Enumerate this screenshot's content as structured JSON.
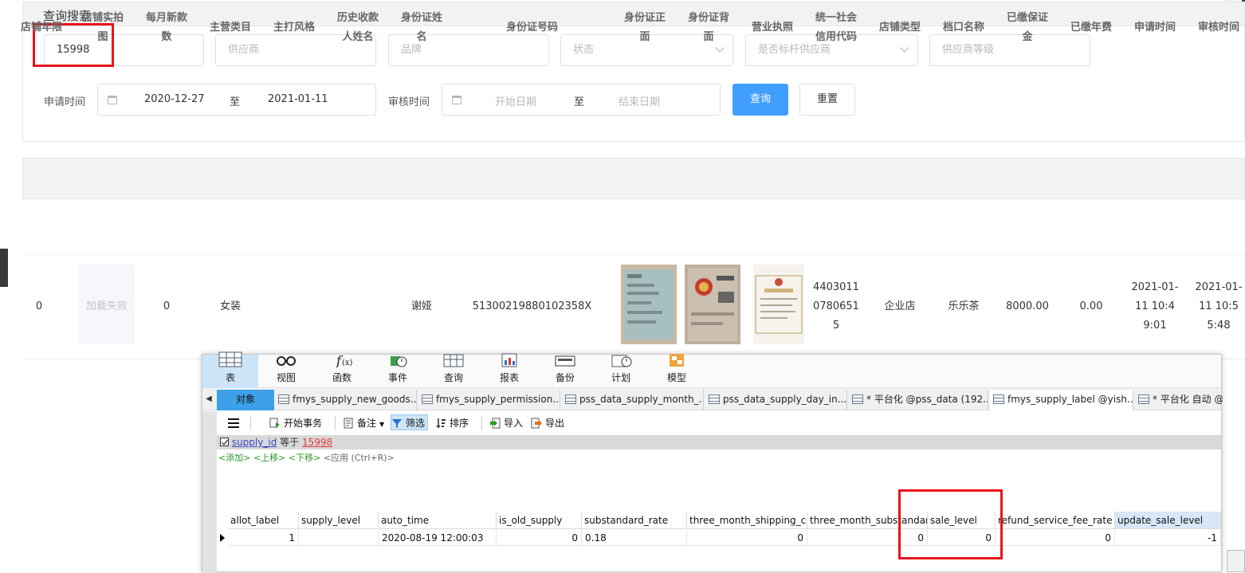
{
  "search": {
    "title": "查询搜索",
    "supply_id_value": "15998",
    "supplier_placeholder": "供应商",
    "brand_placeholder": "品牌",
    "status_placeholder": "状态",
    "benchmark_placeholder": "是否标杆供应商",
    "level_placeholder": "供应商等级",
    "apply_time_label": "申请时间",
    "apply_start": "2020-12-27",
    "range_sep": "至",
    "apply_end": "2021-01-11",
    "audit_time_label": "审核时间",
    "audit_start_placeholder": "开始日期",
    "audit_end_placeholder": "结束日期",
    "query_button": "查询",
    "reset_button": "重置"
  },
  "table": {
    "headers": [
      "店铺年限",
      "店铺实拍图",
      "每月新款数",
      "主营类目",
      "主打风格",
      "历史收款人姓名",
      "身份证姓名",
      "身份证号码",
      "身份证正面",
      "身份证背面",
      "营业执照",
      "统一社会信用代码",
      "店铺类型",
      "档口名称",
      "已缴保证金",
      "已缴年费",
      "申请时间",
      "审核时间"
    ],
    "row": {
      "years": "0",
      "photo_failed": "加载失败",
      "monthly_new": "0",
      "category": "女装",
      "style": "",
      "payee": "",
      "id_name": "谢娅",
      "id_number": "51300219880102358X",
      "credit_code": "440301107806515",
      "store_type": "企业店",
      "stall_name": "乐乐茶",
      "deposit": "8000.00",
      "annual_fee": "0.00",
      "apply_time": "2021-01-11 10:49:01",
      "audit_time": "2021-01-11 10:55:48"
    }
  },
  "navicat": {
    "ribbon": [
      "表",
      "视图",
      "函数",
      "事件",
      "查询",
      "报表",
      "备份",
      "计划",
      "模型"
    ],
    "tabs": [
      "对象",
      "fmys_supply_new_goods...",
      "fmys_supply_permission...",
      "pss_data_supply_month_...",
      "pss_data_supply_day_in...",
      "* 平台化 @pss_data (192...",
      "fmys_supply_label @yish...",
      "* 平台化 自动 @y"
    ],
    "toolbar": {
      "begin_tx": "开始事务",
      "note": "备注",
      "filter": "筛选",
      "sort": "排序",
      "import": "导入",
      "export": "导出"
    },
    "filter": {
      "field": "supply_id",
      "op": "等于",
      "value": "15998",
      "add": "<添加>",
      "up": "<上移>",
      "down": "<下移>",
      "apply": "<应用 (Ctrl+R)>"
    },
    "columns": [
      "allot_label",
      "supply_level",
      "auto_time",
      "is_old_supply",
      "substandard_rate",
      "three_month_shipping_co",
      "three_month_substandarc",
      "sale_level",
      "refund_service_fee_rate",
      "update_sale_level"
    ],
    "row": [
      "1",
      "",
      "2020-08-19 12:00:03",
      "0",
      "0.18",
      "0",
      "0",
      "0",
      "0",
      "-1"
    ]
  },
  "colors": {
    "primary": "#409eff",
    "highlight_red": "#e8141b",
    "active_tab": "#3ca1e8"
  }
}
